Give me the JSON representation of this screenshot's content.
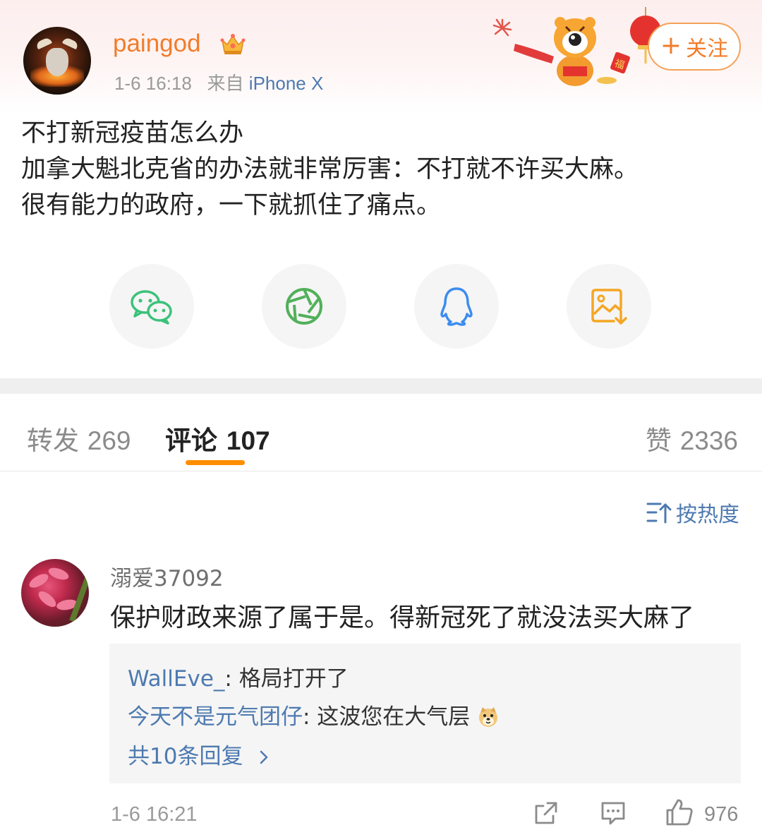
{
  "post": {
    "author": {
      "username": "paingod",
      "badge_icon": "crown-icon"
    },
    "timestamp": "1-6 16:18",
    "source_prefix": "来自",
    "source": "iPhone X",
    "follow_label": "关注",
    "follow_icon": "plus-icon",
    "content_lines": [
      "不打新冠疫苗怎么办",
      "加拿大魁北克省的办法就非常厉害：不打就不许买大麻。",
      "很有能力的政府，一下就抓住了痛点。"
    ]
  },
  "share": [
    {
      "icon": "wechat-icon",
      "color": "#3bc27a"
    },
    {
      "icon": "moments-icon",
      "color": "#52b05a"
    },
    {
      "icon": "qq-icon",
      "color": "#3d8cf0"
    },
    {
      "icon": "save-image-icon",
      "color": "#f5a623"
    }
  ],
  "tabs": {
    "repost": {
      "label": "转发",
      "count": "269"
    },
    "comments": {
      "label": "评论",
      "count": "107"
    },
    "likes": {
      "label": "赞",
      "count": "2336"
    }
  },
  "sort": {
    "label": "按热度",
    "icon": "sort-icon"
  },
  "comment": {
    "username": "溺爱37092",
    "text": "保护财政来源了属于是。得新冠死了就没法买大麻了",
    "replies": [
      {
        "author": "WallEve_",
        "text": ": 格局打开了"
      },
      {
        "author": "今天不是元气团仔",
        "text": ": 这波您在大气层",
        "emoji": "doge-icon"
      }
    ],
    "more_replies": "共10条回复",
    "timestamp": "1-6 16:21",
    "like_count": "976"
  },
  "colors": {
    "accent_orange": "#f27c2a",
    "link_blue": "#4d7ab0",
    "tab_indicator": "#ff8d00"
  }
}
